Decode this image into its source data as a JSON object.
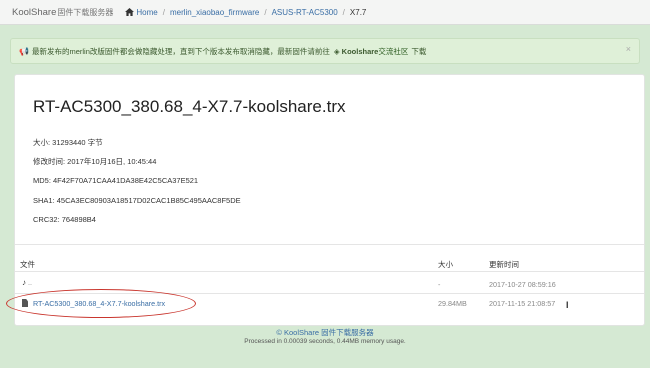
{
  "header": {
    "brand": "KoolShare",
    "brand_sub": "固件下载服务器",
    "breadcrumbs": [
      {
        "label": "Home"
      },
      {
        "label": "merlin_xiaobao_firmware"
      },
      {
        "label": "ASUS-RT-AC5300"
      },
      {
        "label": "X7.7"
      }
    ]
  },
  "alert": {
    "text": "最新发布的merlin改版固件都会做隐藏处理，直到下个版本发布取消隐藏，最新固件请前往",
    "brand": "Koolshare",
    "link": "交流社区",
    "suffix": "下载",
    "close": "×"
  },
  "file": {
    "name": "RT-AC5300_380.68_4-X7.7-koolshare.trx",
    "size_line": "大小: 31293440 字节",
    "mtime_line": "修改时间: 2017年10月16日, 10:45:44",
    "md5_line": "MD5: 4F42F70A71CAA41DA38E42C5CA37E521",
    "sha1_line": "SHA1: 45CA3EC80903A18517D02CAC1B85C495AAC8F5DE",
    "crc32_line": "CRC32: 764898B4"
  },
  "table": {
    "headers": {
      "name": "文件",
      "size": "大小",
      "updated": "更新时间"
    },
    "rows": [
      {
        "name": "..",
        "size": "-",
        "updated": "2017-10-27 08:59:16"
      },
      {
        "name": "RT-AC5300_380.68_4-X7.7-koolshare.trx",
        "size": "29.84MB",
        "updated": "2017-11-15 21:08:57"
      }
    ]
  },
  "footer": {
    "line1": "© KoolShare 固件下载服务器",
    "line2": "Processed in 0.00039 seconds, 0.44MB memory usage."
  },
  "colors": {
    "accent": "#3a6ea5",
    "background": "#d5e9d3",
    "highlight": "#c9362e"
  }
}
